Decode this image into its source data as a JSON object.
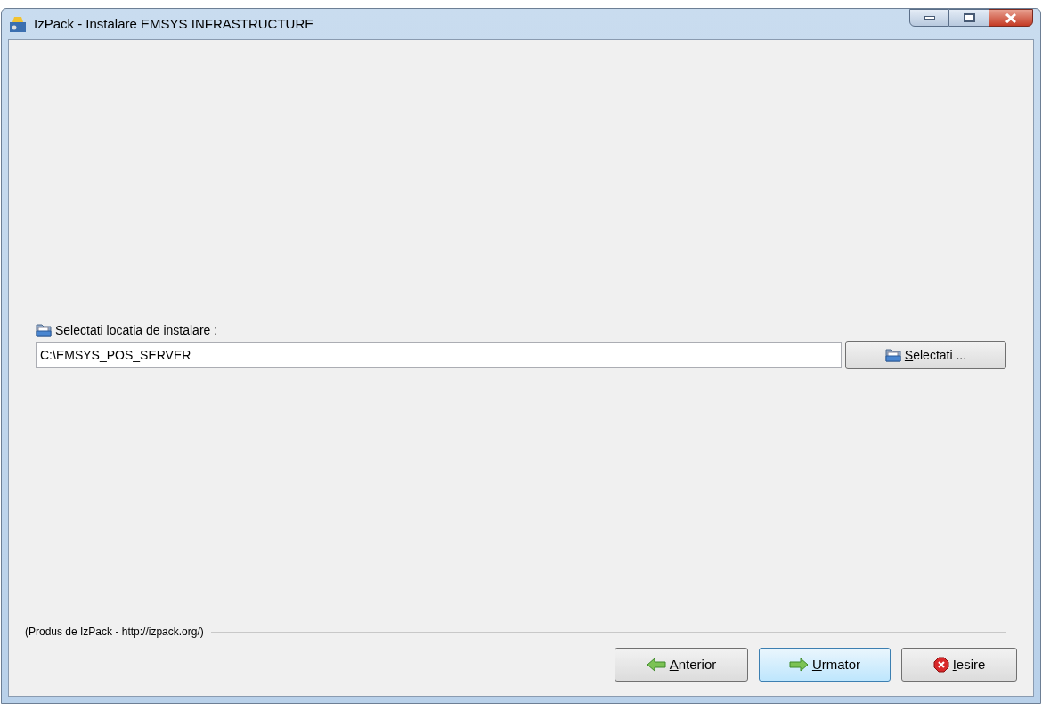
{
  "window": {
    "title": "IzPack - Instalare EMSYS INFRASTRUCTURE"
  },
  "path_label": "Selectati locatia de instalare :",
  "path_field": {
    "value": "C:\\EMSYS_POS_SERVER"
  },
  "browse_button": {
    "label": "Selectati ...",
    "underline_first": true
  },
  "footer": "(Produs de IzPack - http://izpack.org/)",
  "buttons": [
    {
      "kind": "back",
      "label": "Anterior",
      "underline_first": true,
      "focused": false
    },
    {
      "kind": "next",
      "label": "Urmator",
      "underline_first": true,
      "focused": true
    },
    {
      "kind": "quit",
      "label": "Iesire",
      "underline_first": true,
      "focused": false
    }
  ]
}
